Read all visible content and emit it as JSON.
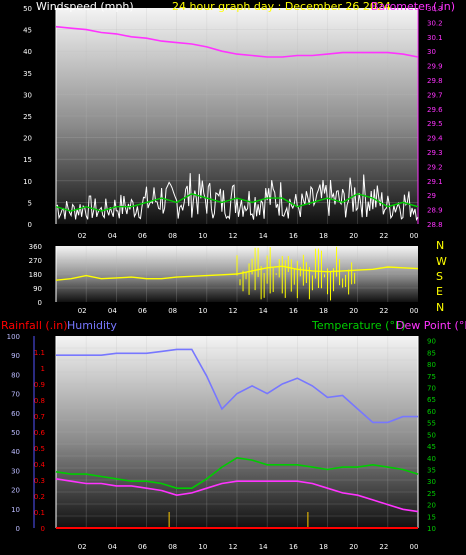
{
  "colors": {
    "windspeed": "#ffffff",
    "wind_avg": "#00cc00",
    "barometer": "#ff33ff",
    "direction": "#ffff00",
    "rainfall": "#ff0000",
    "humidity": "#7777ff",
    "temperature": "#00cc00",
    "dewpoint": "#ff33ff",
    "axis_left": "#5555ff",
    "bg": "#000000"
  },
  "top": {
    "left_title": "Windspeed (mph)",
    "center_title": "24 hour graph day : December 26 2024",
    "right_title": "Barometer (.in)"
  },
  "middle": {
    "compass": [
      "N",
      "W",
      "S",
      "E",
      "N"
    ]
  },
  "bottom": {
    "rainfall_title": "Rainfall (.in)",
    "humidity_title": "Humidity",
    "temperature_title": "Temperature (°F)",
    "dewpoint_title": "Dew Point (°F)"
  },
  "chart_data": [
    {
      "type": "line",
      "title": "24 hour graph day : December 26 2024",
      "x": [
        0,
        2,
        4,
        6,
        8,
        10,
        12,
        14,
        16,
        18,
        20,
        22,
        24
      ],
      "xticks": [
        "02",
        "04",
        "06",
        "08",
        "10",
        "12",
        "14",
        "16",
        "18",
        "20",
        "22",
        "00"
      ],
      "ylabel": "Windspeed (mph)",
      "ylim": [
        0,
        50
      ],
      "yticks": [
        "0",
        "5",
        "10",
        "15",
        "20",
        "25",
        "30",
        "35",
        "40",
        "45",
        "50"
      ],
      "y2label": "Barometer (.in)",
      "y2lim": [
        28.8,
        30.3
      ],
      "y2ticks": [
        "28.8",
        "28.9",
        "29",
        "29.1",
        "29.2",
        "29.3",
        "29.4",
        "29.5",
        "29.6",
        "29.7",
        "29.8",
        "29.9",
        "30",
        "30.1",
        "30.2",
        "30.3"
      ],
      "series": [
        {
          "name": "Windspeed (mph)",
          "axis": "left",
          "values": [
            4,
            3,
            4,
            3,
            4,
            4,
            5,
            6,
            5,
            7,
            6,
            5,
            6,
            5,
            6,
            6,
            4,
            5,
            6,
            5,
            7,
            6,
            4,
            5,
            4
          ]
        },
        {
          "name": "Barometer (.in)",
          "axis": "right",
          "values": [
            30.17,
            30.16,
            30.15,
            30.13,
            30.12,
            30.1,
            30.09,
            30.07,
            30.06,
            30.05,
            30.03,
            30.0,
            29.98,
            29.97,
            29.96,
            29.96,
            29.97,
            29.97,
            29.98,
            29.99,
            29.99,
            29.99,
            29.99,
            29.98,
            29.96
          ]
        }
      ]
    },
    {
      "type": "line",
      "x": [
        0,
        2,
        4,
        6,
        8,
        10,
        12,
        14,
        16,
        18,
        20,
        22,
        24
      ],
      "xticks": [
        "02",
        "04",
        "06",
        "08",
        "10",
        "12",
        "14",
        "16",
        "18",
        "20",
        "22",
        "00"
      ],
      "ylabel": "Wind direction",
      "ylim": [
        0,
        360
      ],
      "yticks": [
        "0",
        "90",
        "180",
        "270",
        "360"
      ],
      "series": [
        {
          "name": "Wind direction",
          "values": [
            140,
            150,
            170,
            150,
            155,
            160,
            150,
            150,
            160,
            165,
            170,
            175,
            180,
            200,
            220,
            230,
            210,
            200,
            195,
            200,
            205,
            210,
            225,
            220,
            215
          ]
        }
      ]
    },
    {
      "type": "line",
      "x": [
        0,
        2,
        4,
        6,
        8,
        10,
        12,
        14,
        16,
        18,
        20,
        22,
        24
      ],
      "xticks": [
        "02",
        "04",
        "06",
        "08",
        "10",
        "12",
        "14",
        "16",
        "18",
        "20",
        "22",
        "00"
      ],
      "ylabel_left_outer": "Rainfall (.in)",
      "ylim_rain": [
        0,
        1.2
      ],
      "yticks_rain": [
        "0",
        "0.1",
        "0.2",
        "0.3",
        "0.4",
        "0.5",
        "0.6",
        "0.7",
        "0.8",
        "0.9",
        "1",
        "1.1"
      ],
      "ylabel_left_inner": "Humidity",
      "ylim_humidity": [
        0,
        100
      ],
      "yticks_humidity": [
        "0",
        "10",
        "20",
        "30",
        "40",
        "50",
        "60",
        "70",
        "80",
        "90",
        "100"
      ],
      "ylabel_right": "Temperature (°F)",
      "ylim_temp": [
        10,
        92
      ],
      "yticks_temp": [
        "10",
        "15",
        "20",
        "25",
        "30",
        "35",
        "40",
        "45",
        "50",
        "55",
        "60",
        "65",
        "70",
        "75",
        "80",
        "85",
        "90"
      ],
      "series": [
        {
          "name": "Humidity",
          "axis": "humidity",
          "values": [
            90,
            90,
            90,
            90,
            91,
            91,
            91,
            92,
            93,
            93,
            79,
            62,
            70,
            74,
            70,
            75,
            78,
            74,
            68,
            69,
            62,
            55,
            55,
            58,
            58
          ]
        },
        {
          "name": "Temperature (°F)",
          "axis": "temp",
          "values": [
            34,
            33,
            33,
            32,
            31,
            30,
            30,
            29,
            27,
            27,
            31,
            36,
            40,
            39,
            37,
            37,
            37,
            36,
            35,
            36,
            36,
            37,
            36,
            35,
            33
          ]
        },
        {
          "name": "Dew Point (°F)",
          "axis": "temp",
          "values": [
            31,
            30,
            29,
            29,
            28,
            28,
            27,
            26,
            24,
            25,
            27,
            29,
            30,
            30,
            30,
            30,
            30,
            29,
            27,
            25,
            24,
            22,
            20,
            18,
            17
          ]
        },
        {
          "name": "Rainfall (.in)",
          "axis": "rain",
          "values": [
            0,
            0,
            0,
            0,
            0,
            0,
            0,
            0,
            0,
            0,
            0,
            0,
            0,
            0,
            0,
            0,
            0,
            0,
            0,
            0,
            0,
            0,
            0,
            0,
            0
          ]
        }
      ]
    }
  ]
}
